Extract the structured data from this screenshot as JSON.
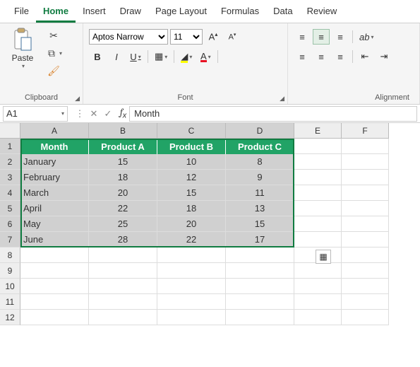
{
  "tabs": [
    "File",
    "Home",
    "Insert",
    "Draw",
    "Page Layout",
    "Formulas",
    "Data",
    "Review"
  ],
  "active_tab": "Home",
  "clipboard": {
    "paste": "Paste",
    "group": "Clipboard"
  },
  "font": {
    "name": "Aptos Narrow",
    "size": "11",
    "group": "Font",
    "bold": "B",
    "italic": "I",
    "underline": "U"
  },
  "align": {
    "group": "Alignment"
  },
  "namebox": "A1",
  "formula_value": "Month",
  "col_heads": [
    "A",
    "B",
    "C",
    "D",
    "E",
    "F"
  ],
  "row_heads": [
    "1",
    "2",
    "3",
    "4",
    "5",
    "6",
    "7",
    "8",
    "9",
    "10",
    "11",
    "12"
  ],
  "table": {
    "header": [
      "Month",
      "Product A",
      "Product B",
      "Product C"
    ],
    "rows": [
      [
        "January",
        "15",
        "10",
        "8"
      ],
      [
        "February",
        "18",
        "12",
        "9"
      ],
      [
        "March",
        "20",
        "15",
        "11"
      ],
      [
        "April",
        "22",
        "18",
        "13"
      ],
      [
        "May",
        "25",
        "20",
        "15"
      ],
      [
        "June",
        "28",
        "22",
        "17"
      ]
    ]
  }
}
